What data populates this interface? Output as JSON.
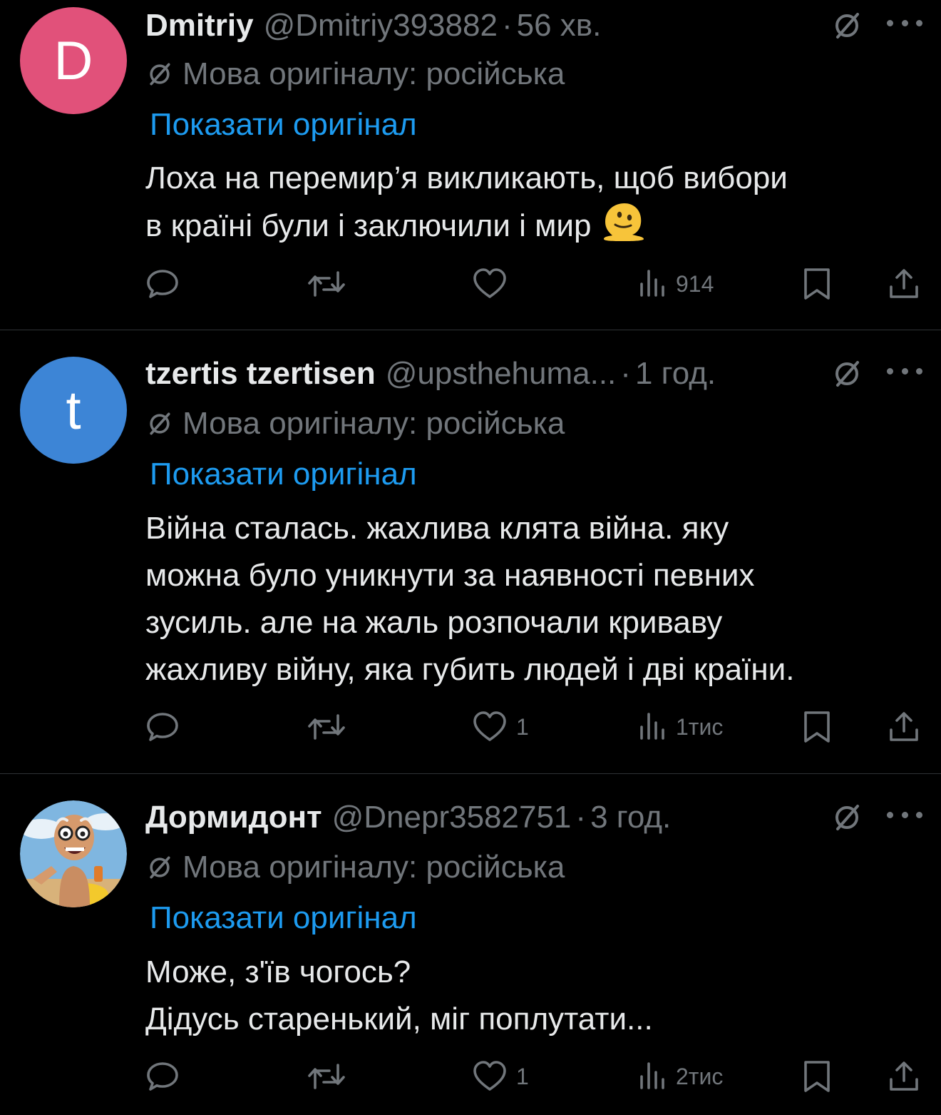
{
  "posts": [
    {
      "avatar_letter": "D",
      "avatar_color": "#e1517a",
      "name": "Dmitriy",
      "handle": "@Dmitriy393882",
      "time": "56 хв.",
      "lang_note": "Мова оригіналу: російська",
      "show_original": "Показати оригінал",
      "body_lines": [
        "Лоха на перемир’я викликають, щоб вибори",
        "в країні були і заключили і мир"
      ],
      "emoji": "melting-face-emoji",
      "likes": "",
      "views": "914"
    },
    {
      "avatar_letter": "t",
      "avatar_color": "#3d85d6",
      "name": "tzertis tzertisen",
      "handle": "@upsthehuma...",
      "time": "1 год.",
      "lang_note": "Мова оригіналу: російська",
      "show_original": "Показати оригінал",
      "body_lines": [
        "Війна сталась. жахлива клята війна. яку",
        "можна було уникнути за наявності певних",
        "зусиль. але на жаль розпочали криваву",
        "жахливу війну, яка губить людей і дві країни."
      ],
      "likes": "1",
      "views": "1тис"
    },
    {
      "avatar_letter": "",
      "avatar_image": "cartoon-old-man-avatar",
      "name": "Дормидонт",
      "handle": "@Dnepr3582751",
      "time": "3 год.",
      "lang_note": "Мова оригіналу: російська",
      "show_original": "Показати оригінал",
      "body_lines": [
        "Може, з'їв чогось?",
        "Дідусь старенький, міг поплутати..."
      ],
      "likes": "1",
      "views": "2тис"
    }
  ],
  "separator": "·",
  "colors": {
    "background": "#000000",
    "text": "#e7e9ea",
    "muted": "#71767b",
    "link": "#1d9bf0",
    "divider": "#2f3336"
  },
  "icons": [
    "translate-slash-icon",
    "more-icon",
    "reply-icon",
    "repost-icon",
    "like-icon",
    "views-icon",
    "bookmark-icon",
    "share-icon"
  ]
}
